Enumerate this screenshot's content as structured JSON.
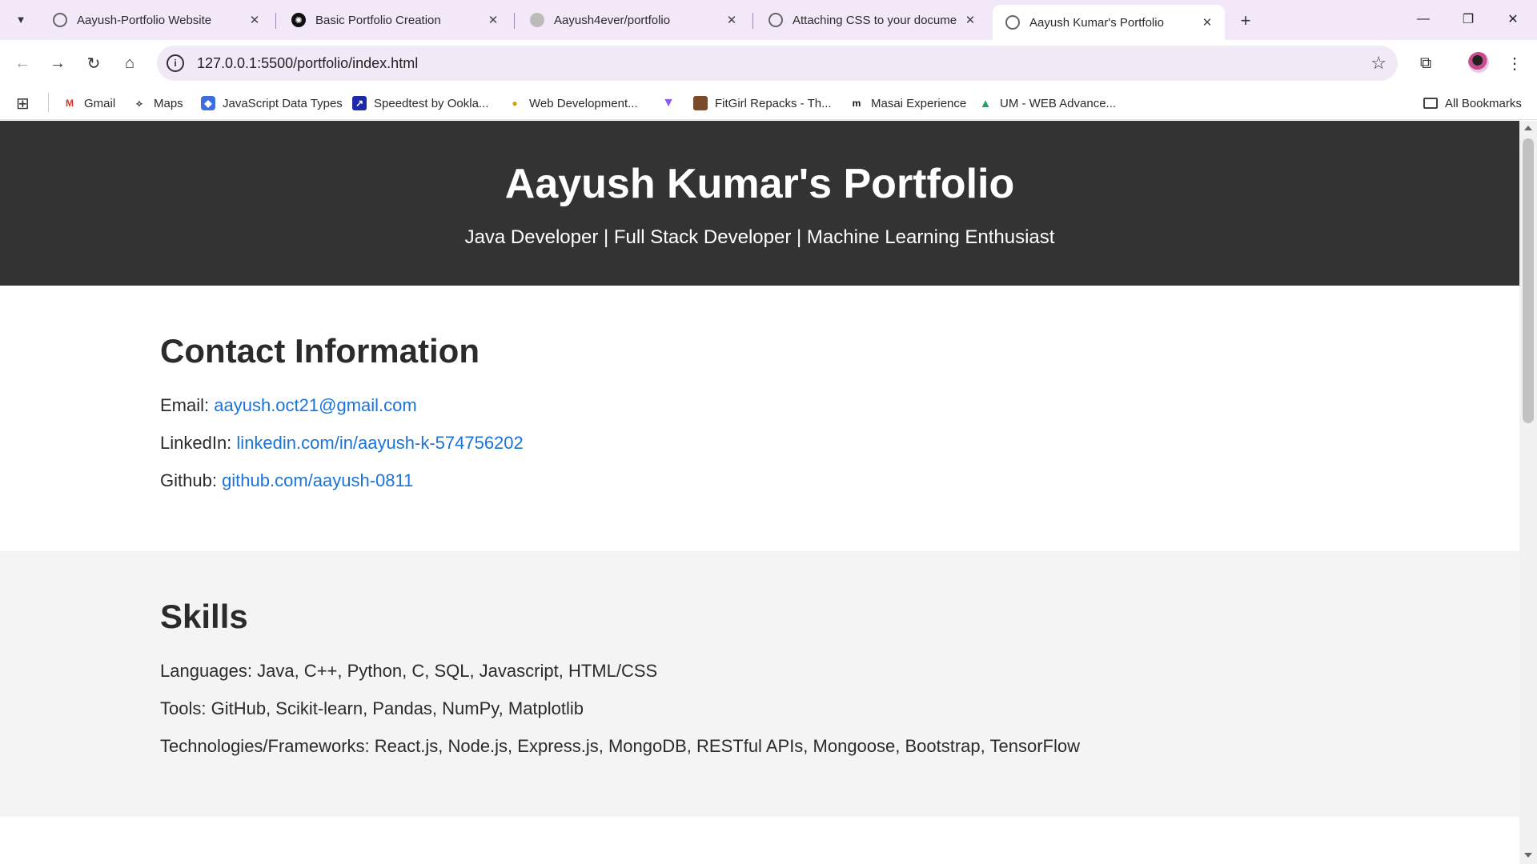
{
  "browser": {
    "tabs": [
      {
        "title": "Aayush-Portfolio Website"
      },
      {
        "title": "Basic Portfolio Creation"
      },
      {
        "title": "Aayush4ever/portfolio"
      },
      {
        "title": "Attaching CSS to your documen"
      },
      {
        "title": "Aayush Kumar's Portfolio"
      }
    ],
    "url": "127.0.0.1:5500/portfolio/index.html",
    "bookmarks": [
      {
        "label": "Gmail"
      },
      {
        "label": "Maps"
      },
      {
        "label": "JavaScript Data Types"
      },
      {
        "label": "Speedtest by Ookla..."
      },
      {
        "label": "Web Development..."
      },
      {
        "label": "FitGirl Repacks - Th..."
      },
      {
        "label": "Masai Experience"
      },
      {
        "label": "UM - WEB Advance..."
      }
    ],
    "all_bookmarks": "All Bookmarks",
    "icons": {
      "tab_search": "chevron-down-icon",
      "new_tab": "plus-icon",
      "minimize": "minimize-icon",
      "restore": "restore-icon",
      "close": "close-icon",
      "back": "arrow-left-icon",
      "forward": "arrow-right-icon",
      "reload": "reload-icon",
      "home": "home-icon",
      "site_info": "info-icon",
      "bookmark_star": "star-icon",
      "extensions": "puzzle-icon",
      "menu": "kebab-menu-icon",
      "apps": "apps-grid-icon",
      "folder": "folder-icon"
    }
  },
  "page": {
    "header": {
      "title": "Aayush Kumar's Portfolio",
      "subtitle": "Java Developer | Full Stack Developer | Machine Learning Enthusiast"
    },
    "contact": {
      "heading": "Contact Information",
      "email_label": "Email:",
      "email": "aayush.oct21@gmail.com",
      "linkedin_label": "LinkedIn:",
      "linkedin": "linkedin.com/in/aayush-k-574756202",
      "github_label": "Github:",
      "github": "github.com/aayush-0811"
    },
    "skills": {
      "heading": "Skills",
      "languages": "Languages: Java, C++, Python, C, SQL, Javascript, HTML/CSS",
      "tools": "Tools: GitHub, Scikit-learn, Pandas, NumPy, Matplotlib",
      "technologies": "Technologies/Frameworks: React.js, Node.js, Express.js, MongoDB, RESTful APIs, Mongoose, Bootstrap, TensorFlow"
    }
  },
  "colors": {
    "header_bg": "#333333",
    "link": "#1a73d9",
    "skills_bg": "#f4f4f4",
    "tabbar_bg": "#f3e8f8"
  }
}
